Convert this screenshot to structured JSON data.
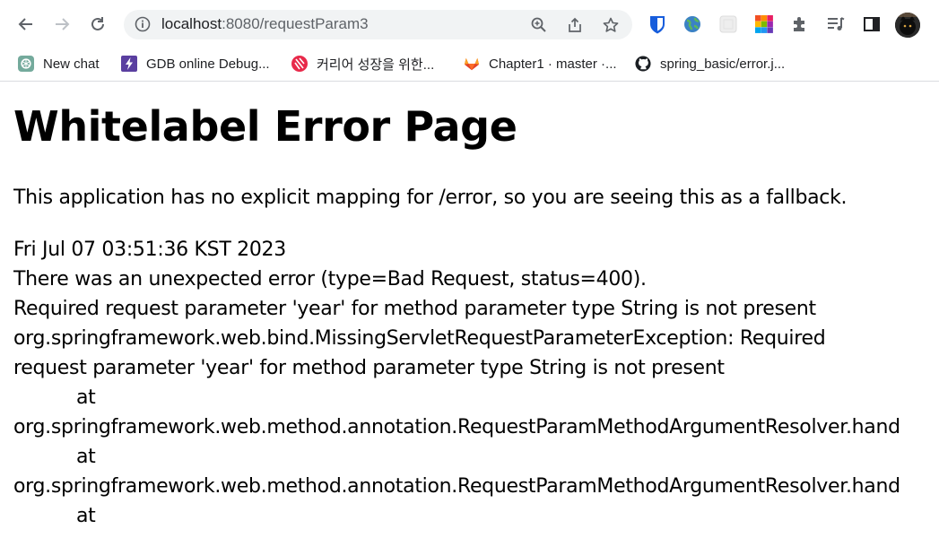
{
  "browser": {
    "url_host": "localhost",
    "url_rest": ":8080/requestParam3"
  },
  "bookmarks": [
    {
      "label": "New chat",
      "icon": "openai-icon"
    },
    {
      "label": "GDB online Debug...",
      "icon": "gdb-icon"
    },
    {
      "label": "커리어 성장을 위한...",
      "icon": "career-icon"
    },
    {
      "label": "Chapter1 · master ·...",
      "icon": "gitlab-icon"
    },
    {
      "label": "spring_basic/error.j...",
      "icon": "github-icon"
    }
  ],
  "page": {
    "title": "Whitelabel Error Page",
    "description": "This application has no explicit mapping for /error, so you are seeing this as a fallback.",
    "timestamp": "Fri Jul 07 03:51:36 KST 2023",
    "error_lines": [
      "There was an unexpected error (type=Bad Request, status=400).",
      "Required request parameter 'year' for method parameter type String is not present",
      "org.springframework.web.bind.MissingServletRequestParameterException: Required",
      "request parameter 'year' for method parameter type String is not present",
      "at",
      "org.springframework.web.method.annotation.RequestParamMethodArgumentResolver.hand",
      "at",
      "org.springframework.web.method.annotation.RequestParamMethodArgumentResolver.hand",
      "at"
    ]
  }
}
